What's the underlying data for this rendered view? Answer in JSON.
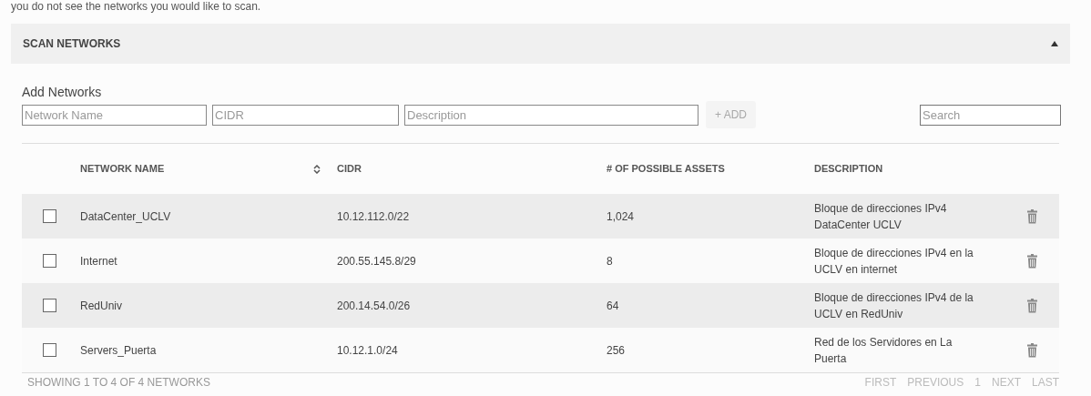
{
  "intro": "you do not see the networks you would like to scan.",
  "panel": {
    "title": "SCAN NETWORKS",
    "expanded": true
  },
  "add_form": {
    "label": "Add Networks",
    "fields": [
      {
        "placeholder": "Network Name"
      },
      {
        "placeholder": "CIDR"
      },
      {
        "placeholder": "Description"
      }
    ],
    "add_button": {
      "label": "+ ADD",
      "disabled": true
    }
  },
  "search": {
    "placeholder": "Search"
  },
  "table": {
    "columns": [
      {
        "label": "NETWORK NAME",
        "sortable": true
      },
      {
        "label": "CIDR",
        "sortable": false
      },
      {
        "label": "# OF POSSIBLE ASSETS",
        "sortable": false
      },
      {
        "label": "DESCRIPTION",
        "sortable": false
      }
    ],
    "rows": [
      {
        "checked": false,
        "name": "DataCenter_UCLV",
        "cidr": "10.12.112.0/22",
        "assets": "1,024",
        "description": "Bloque de direcciones IPv4 DataCenter UCLV"
      },
      {
        "checked": false,
        "name": "Internet",
        "cidr": "200.55.145.8/29",
        "assets": "8",
        "description": "Bloque de direcciones IPv4 en la UCLV en internet"
      },
      {
        "checked": false,
        "name": "RedUniv",
        "cidr": "200.14.54.0/26",
        "assets": "64",
        "description": "Bloque de direcciones IPv4 de la UCLV en RedUniv"
      },
      {
        "checked": false,
        "name": "Servers_Puerta",
        "cidr": "10.12.1.0/24",
        "assets": "256",
        "description": "Red de los Servidores en La Puerta"
      }
    ]
  },
  "footer": {
    "summary": "SHOWING 1 TO 4 OF 4 NETWORKS",
    "pagination": [
      {
        "label": "FIRST",
        "disabled": true
      },
      {
        "label": "PREVIOUS",
        "disabled": true
      },
      {
        "label": "1",
        "disabled": true
      },
      {
        "label": "NEXT",
        "disabled": true
      },
      {
        "label": "LAST",
        "disabled": true
      }
    ]
  }
}
